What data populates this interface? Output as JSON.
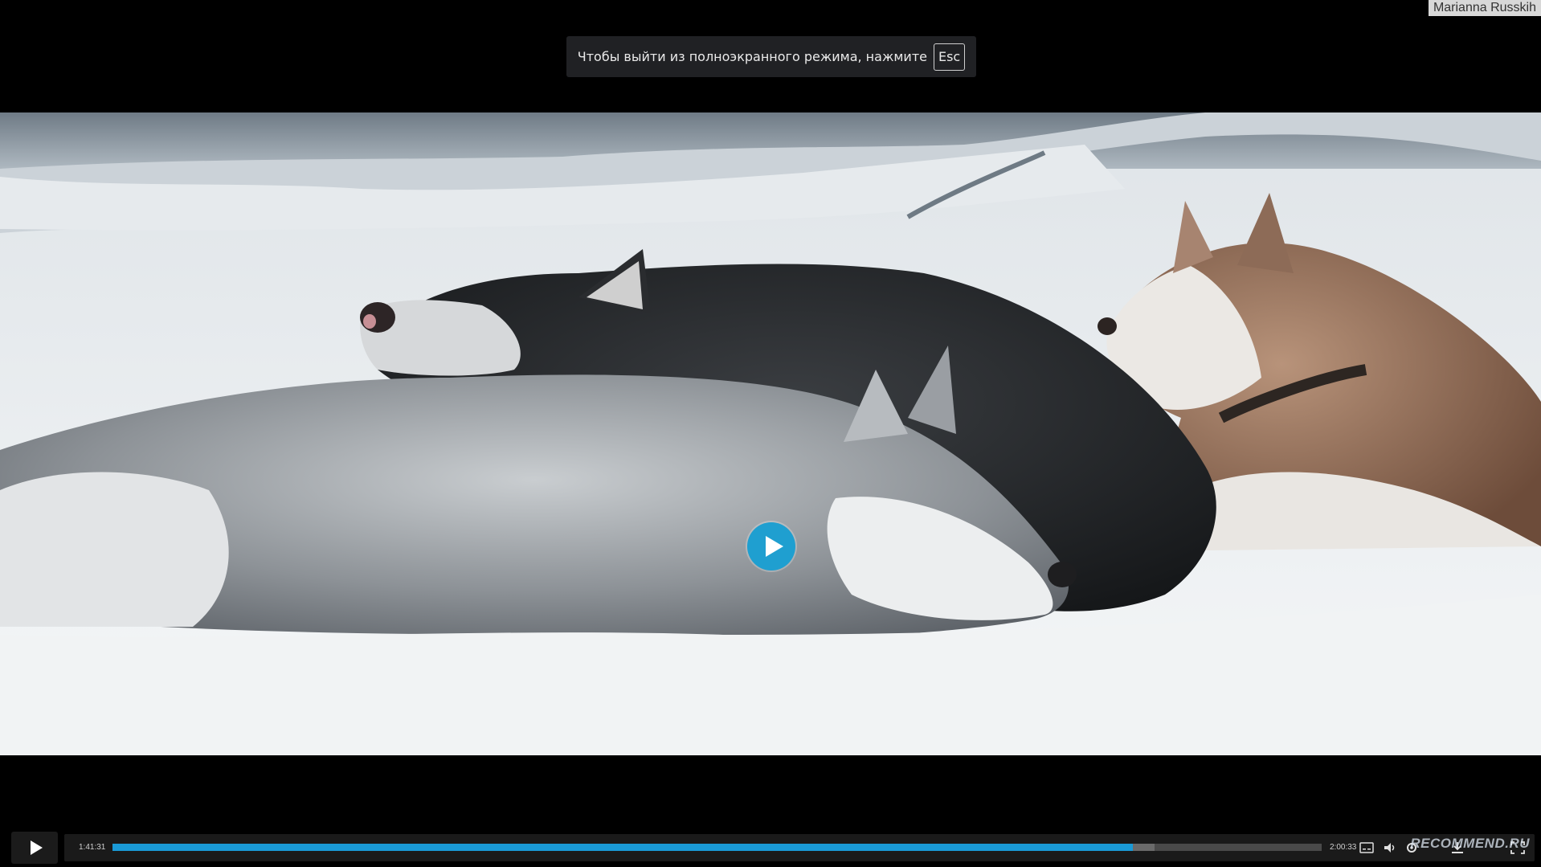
{
  "watermark_author": "Marianna Russkih",
  "fullscreen_hint": {
    "text": "Чтобы выйти из полноэкранного режима, нажмите",
    "key": "Esc"
  },
  "player": {
    "current_time": "1:41:31",
    "total_time": "2:00:33",
    "progress_fraction": 0.844,
    "buffered_fraction": 0.862,
    "accent_color": "#1a9ad6"
  },
  "icons": {
    "subtitles": "subtitles-icon",
    "volume": "volume-icon",
    "settings": "settings-icon",
    "download": "download-icon",
    "fullscreen": "fullscreen-icon"
  },
  "site_watermark": "RECOMMEND.RU"
}
